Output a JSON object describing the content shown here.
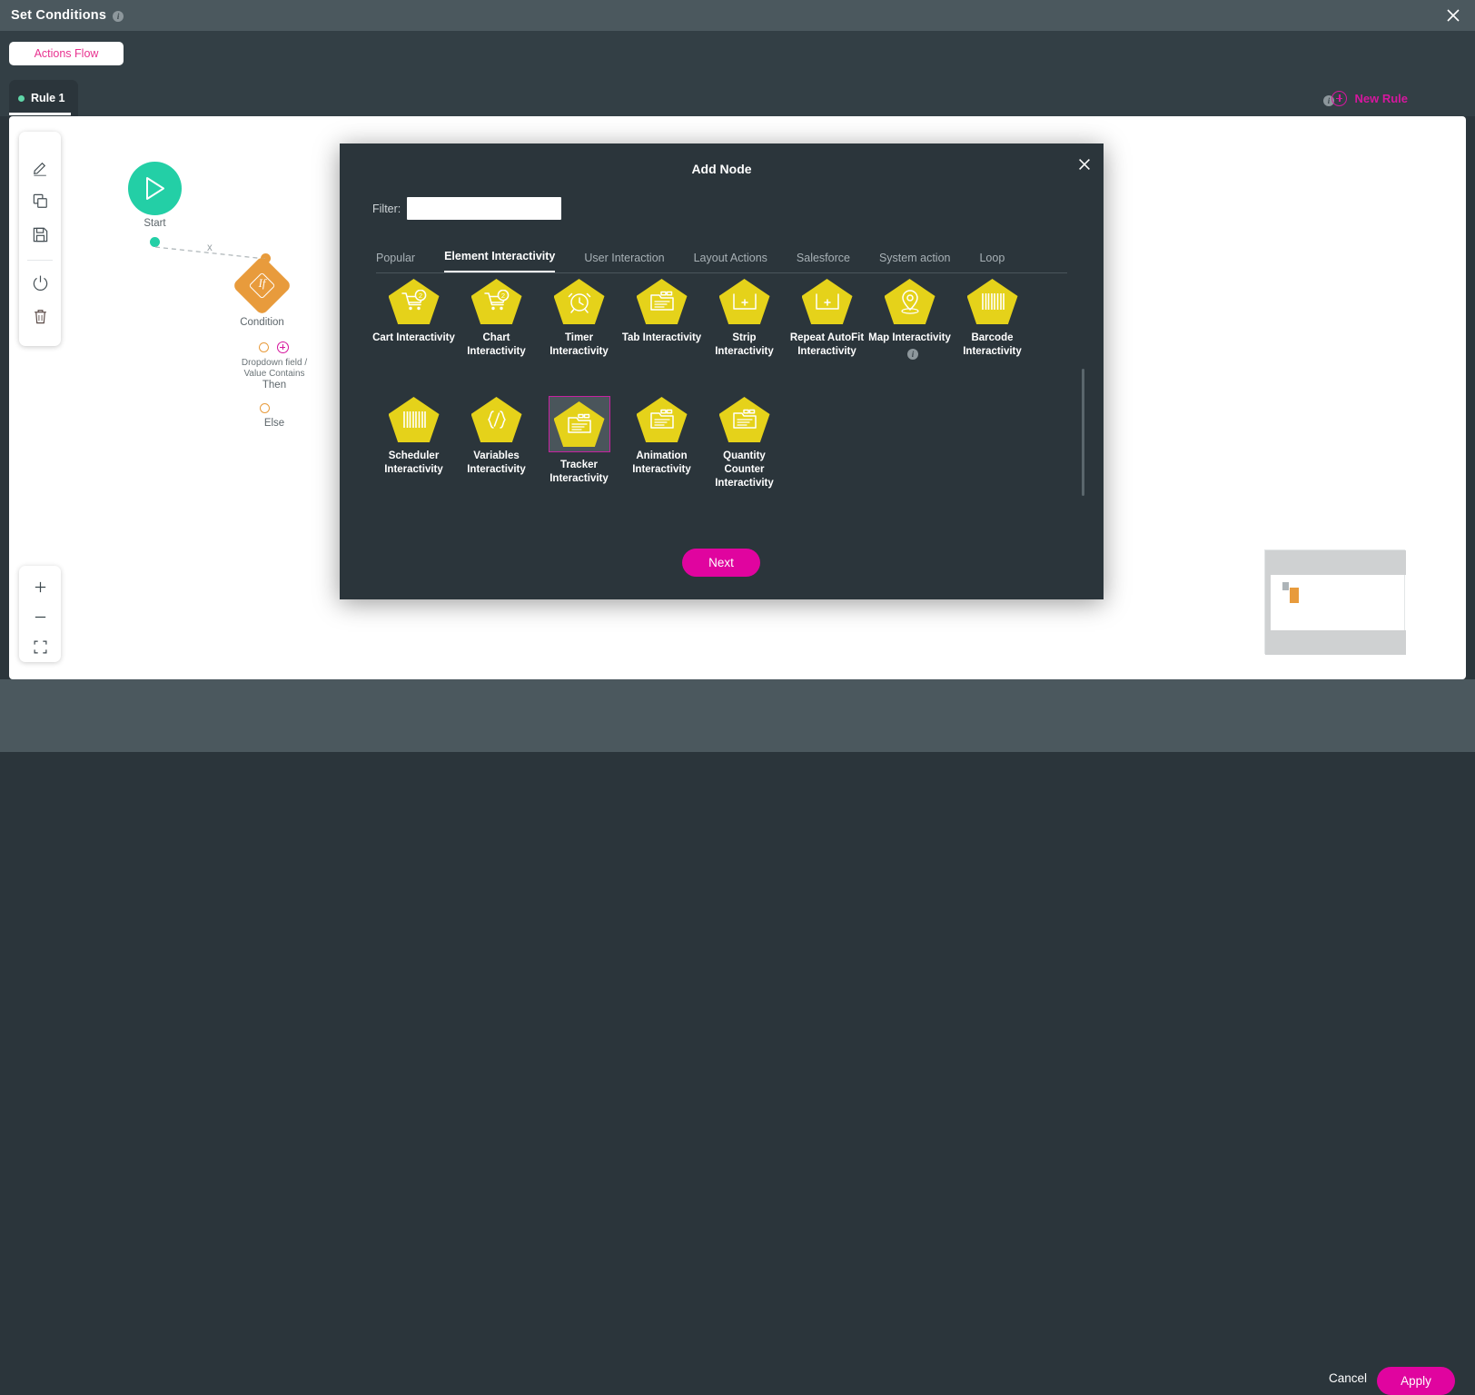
{
  "window": {
    "title": "Set Conditions",
    "title_info_icon": "info-icon",
    "close_icon": "close-icon"
  },
  "toolbar": {
    "actions_flow_label": "Actions Flow"
  },
  "rule_bar": {
    "rule_tab_label": "Rule 1",
    "new_rule_label": "New Rule",
    "new_rule_info_icon": "info-icon"
  },
  "left_tools": [
    {
      "name": "edit-tool",
      "icon": "pencil-icon"
    },
    {
      "name": "copy-tool",
      "icon": "copy-icon"
    },
    {
      "name": "save-tool",
      "icon": "save-icon"
    },
    {
      "name": "power-tool",
      "icon": "power-icon"
    },
    {
      "name": "delete-tool",
      "icon": "trash-icon"
    }
  ],
  "zoom_tools": [
    {
      "name": "zoom-in-button",
      "glyph": "+"
    },
    {
      "name": "zoom-out-button",
      "glyph": "−"
    },
    {
      "name": "fit-to-screen-button",
      "glyph": "fit-icon"
    }
  ],
  "flow": {
    "start_label": "Start",
    "start_icon": "play-icon",
    "edge_label": "x",
    "condition_label": "Condition",
    "condition_glyph": "If",
    "then_desc_line1": "Dropdown field /",
    "then_desc_line2": "Value Contains",
    "then_label": "Then",
    "else_label": "Else",
    "add_branch_icon": "plus-circle-icon"
  },
  "minimap": {
    "name": "canvas-minimap"
  },
  "dialog": {
    "title": "Add Node",
    "close_icon": "close-icon",
    "filter_label": "Filter:",
    "filter_value": "",
    "filter_placeholder": "",
    "tabs": [
      {
        "label": "Popular",
        "active": false
      },
      {
        "label": "Element Interactivity",
        "active": true
      },
      {
        "label": "User Interaction",
        "active": false
      },
      {
        "label": "Layout Actions",
        "active": false
      },
      {
        "label": "Salesforce",
        "active": false
      },
      {
        "label": "System action",
        "active": false
      },
      {
        "label": "Loop",
        "active": false
      }
    ],
    "nodes": [
      {
        "label": "Cart Interactivity",
        "icon": "cart-icon",
        "selected": false,
        "info": false
      },
      {
        "label": "Chart Interactivity",
        "icon": "cart-icon",
        "selected": false,
        "info": false
      },
      {
        "label": "Timer Interactivity",
        "icon": "alarm-clock-icon",
        "selected": false,
        "info": false
      },
      {
        "label": "Tab Interactivity",
        "icon": "tab-window-icon",
        "selected": false,
        "info": false
      },
      {
        "label": "Strip Interactivity",
        "icon": "strip-plus-icon",
        "selected": false,
        "info": false
      },
      {
        "label": "Repeat AutoFit Interactivity",
        "icon": "strip-plus-icon",
        "selected": false,
        "info": false
      },
      {
        "label": "Map Interactivity",
        "icon": "map-pin-icon",
        "selected": false,
        "info": true
      },
      {
        "label": "Barcode Interactivity",
        "icon": "barcode-icon",
        "selected": false,
        "info": false
      },
      {
        "label": "Scheduler Interactivity",
        "icon": "barcode-icon",
        "selected": false,
        "info": false
      },
      {
        "label": "Variables Interactivity",
        "icon": "code-braces-icon",
        "selected": false,
        "info": false
      },
      {
        "label": "Tracker Interactivity",
        "icon": "tab-window-icon",
        "selected": true,
        "info": false
      },
      {
        "label": "Animation Interactivity",
        "icon": "tab-window-icon",
        "selected": false,
        "info": false
      },
      {
        "label": "Quantity Counter Interactivity",
        "icon": "tab-window-icon",
        "selected": false,
        "info": false
      }
    ],
    "next_label": "Next"
  },
  "footer": {
    "cancel_label": "Cancel",
    "apply_label": "Apply"
  },
  "colors": {
    "accent_pink": "#e0049f",
    "node_yellow": "#e5d21a",
    "start_green": "#23cfa6",
    "condition_orange": "#e89b3c",
    "selection_border": "#c622a0",
    "panel_dark": "#2b353b",
    "bar_gray": "#4b585e"
  }
}
